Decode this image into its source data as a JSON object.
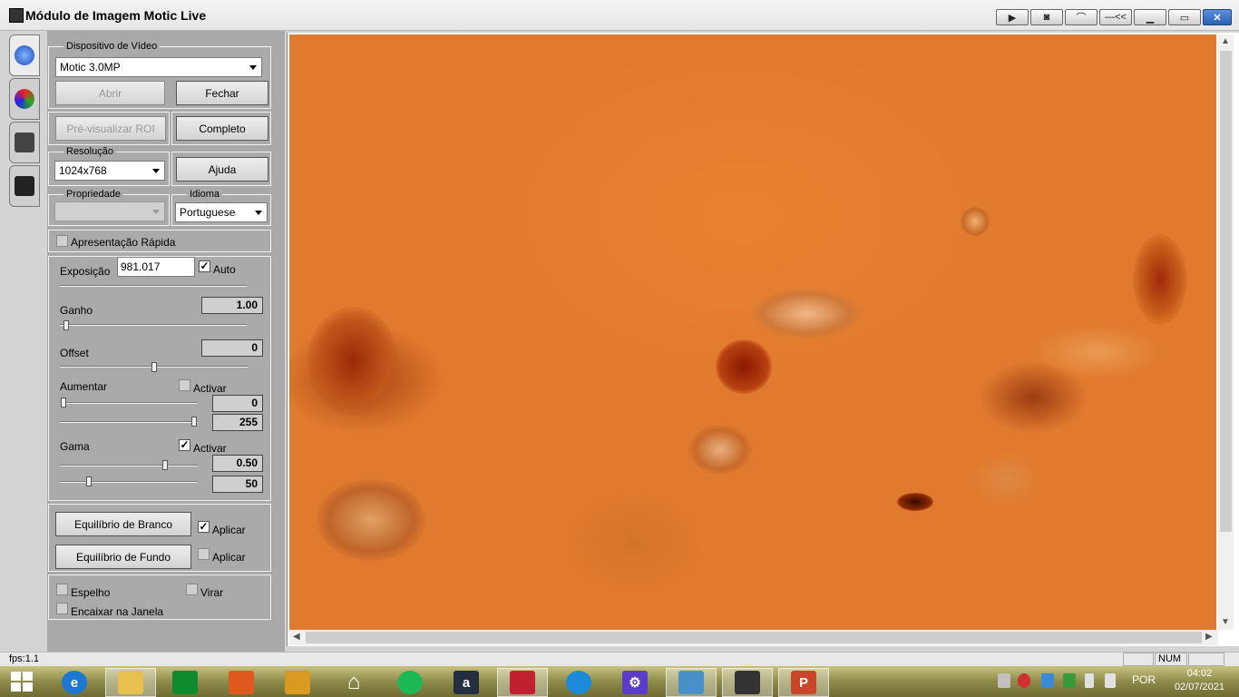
{
  "window": {
    "title": "Módulo de Imagem Motic Live",
    "controls": [
      "play-icon",
      "camera-icon",
      "microscope-icon",
      "collapse-icon",
      "minimize-icon",
      "maximize-icon",
      "close-icon"
    ],
    "collapse_label": "—<<"
  },
  "tabs": [
    {
      "icon": "capture-settings-icon"
    },
    {
      "icon": "color-icon"
    },
    {
      "icon": "tools-icon"
    },
    {
      "icon": "camera-icon"
    }
  ],
  "panel": {
    "video_device": {
      "legend": "Dispositivo de Vídeo",
      "device": "Motic 3.0MP",
      "open_label": "Abrir",
      "close_label": "Fechar"
    },
    "preview_roi_label": "Pré-visualizar ROI",
    "full_label": "Completo",
    "resolution": {
      "legend": "Resolução",
      "value": "1024x768"
    },
    "help_label": "Ajuda",
    "property": {
      "legend": "Propriedade",
      "value": ""
    },
    "language": {
      "legend": "Idioma",
      "value": "Portuguese"
    },
    "quick_preview_label": "Apresentação Rápida",
    "exposure": {
      "label": "Exposição",
      "value": "981.017",
      "auto_label": "Auto",
      "auto_checked": true
    },
    "gain": {
      "label": "Ganho",
      "value": "1.00",
      "level": 0.02
    },
    "offset": {
      "label": "Offset",
      "value": "0",
      "level": 0.5
    },
    "enhance": {
      "label": "Aumentar",
      "activate_label": "Activar",
      "activate_checked": false,
      "low": "0",
      "high": "255",
      "low_level": 0.0,
      "high_level": 1.0
    },
    "gamma": {
      "label": "Gama",
      "activate_label": "Activar",
      "activate_checked": true,
      "value1": "0.50",
      "value2": "50",
      "level1": 0.76,
      "level2": 0.2
    },
    "white_balance_label": "Equilíbrio de Branco",
    "white_balance_apply": "Aplicar",
    "white_balance_checked": true,
    "background_balance_label": "Equilíbrio de Fundo",
    "background_balance_apply": "Aplicar",
    "background_balance_checked": false,
    "mirror_label": "Espelho",
    "flip_label": "Virar",
    "fit_window_label": "Encaixar na Janela"
  },
  "status": {
    "fps": "fps:1.1",
    "num": "NUM"
  },
  "taskbar": {
    "apps": [
      "internet-explorer-icon",
      "file-explorer-icon",
      "store-icon",
      "photos-icon",
      "notes-icon",
      "home-icon",
      "spotify-icon",
      "amazon-icon",
      "motic-icon",
      "edge-icon",
      "settings-icon",
      "image-viewer-icon",
      "motic-live-icon",
      "powerpoint-icon"
    ],
    "amazon_glyph": "a",
    "powerpoint_glyph": "P",
    "language": "POR",
    "time": "04:02",
    "date": "02/07/2021"
  }
}
